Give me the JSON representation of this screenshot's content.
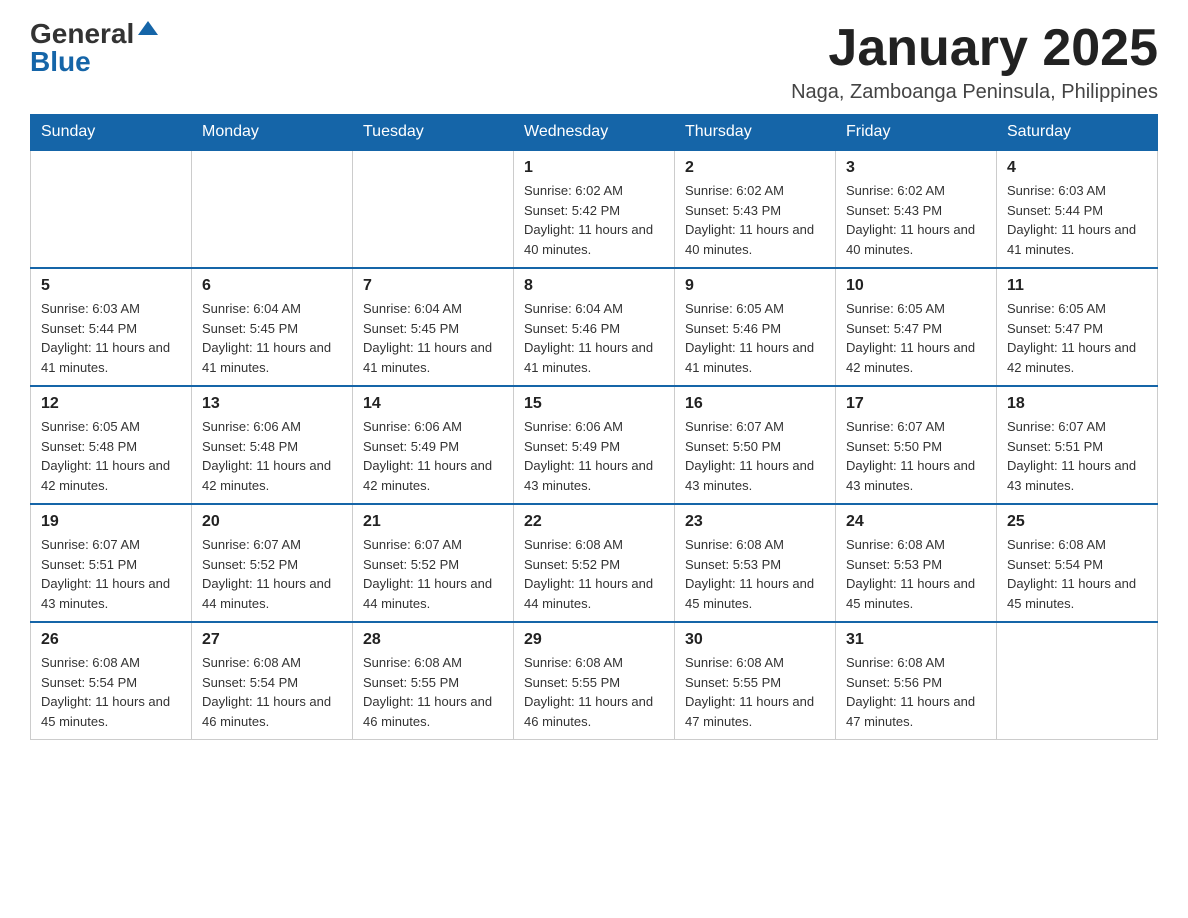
{
  "header": {
    "logo_general": "General",
    "logo_blue": "Blue",
    "title": "January 2025",
    "location": "Naga, Zamboanga Peninsula, Philippines"
  },
  "days_of_week": [
    "Sunday",
    "Monday",
    "Tuesday",
    "Wednesday",
    "Thursday",
    "Friday",
    "Saturday"
  ],
  "weeks": [
    [
      {
        "day": "",
        "info": ""
      },
      {
        "day": "",
        "info": ""
      },
      {
        "day": "",
        "info": ""
      },
      {
        "day": "1",
        "info": "Sunrise: 6:02 AM\nSunset: 5:42 PM\nDaylight: 11 hours and 40 minutes."
      },
      {
        "day": "2",
        "info": "Sunrise: 6:02 AM\nSunset: 5:43 PM\nDaylight: 11 hours and 40 minutes."
      },
      {
        "day": "3",
        "info": "Sunrise: 6:02 AM\nSunset: 5:43 PM\nDaylight: 11 hours and 40 minutes."
      },
      {
        "day": "4",
        "info": "Sunrise: 6:03 AM\nSunset: 5:44 PM\nDaylight: 11 hours and 41 minutes."
      }
    ],
    [
      {
        "day": "5",
        "info": "Sunrise: 6:03 AM\nSunset: 5:44 PM\nDaylight: 11 hours and 41 minutes."
      },
      {
        "day": "6",
        "info": "Sunrise: 6:04 AM\nSunset: 5:45 PM\nDaylight: 11 hours and 41 minutes."
      },
      {
        "day": "7",
        "info": "Sunrise: 6:04 AM\nSunset: 5:45 PM\nDaylight: 11 hours and 41 minutes."
      },
      {
        "day": "8",
        "info": "Sunrise: 6:04 AM\nSunset: 5:46 PM\nDaylight: 11 hours and 41 minutes."
      },
      {
        "day": "9",
        "info": "Sunrise: 6:05 AM\nSunset: 5:46 PM\nDaylight: 11 hours and 41 minutes."
      },
      {
        "day": "10",
        "info": "Sunrise: 6:05 AM\nSunset: 5:47 PM\nDaylight: 11 hours and 42 minutes."
      },
      {
        "day": "11",
        "info": "Sunrise: 6:05 AM\nSunset: 5:47 PM\nDaylight: 11 hours and 42 minutes."
      }
    ],
    [
      {
        "day": "12",
        "info": "Sunrise: 6:05 AM\nSunset: 5:48 PM\nDaylight: 11 hours and 42 minutes."
      },
      {
        "day": "13",
        "info": "Sunrise: 6:06 AM\nSunset: 5:48 PM\nDaylight: 11 hours and 42 minutes."
      },
      {
        "day": "14",
        "info": "Sunrise: 6:06 AM\nSunset: 5:49 PM\nDaylight: 11 hours and 42 minutes."
      },
      {
        "day": "15",
        "info": "Sunrise: 6:06 AM\nSunset: 5:49 PM\nDaylight: 11 hours and 43 minutes."
      },
      {
        "day": "16",
        "info": "Sunrise: 6:07 AM\nSunset: 5:50 PM\nDaylight: 11 hours and 43 minutes."
      },
      {
        "day": "17",
        "info": "Sunrise: 6:07 AM\nSunset: 5:50 PM\nDaylight: 11 hours and 43 minutes."
      },
      {
        "day": "18",
        "info": "Sunrise: 6:07 AM\nSunset: 5:51 PM\nDaylight: 11 hours and 43 minutes."
      }
    ],
    [
      {
        "day": "19",
        "info": "Sunrise: 6:07 AM\nSunset: 5:51 PM\nDaylight: 11 hours and 43 minutes."
      },
      {
        "day": "20",
        "info": "Sunrise: 6:07 AM\nSunset: 5:52 PM\nDaylight: 11 hours and 44 minutes."
      },
      {
        "day": "21",
        "info": "Sunrise: 6:07 AM\nSunset: 5:52 PM\nDaylight: 11 hours and 44 minutes."
      },
      {
        "day": "22",
        "info": "Sunrise: 6:08 AM\nSunset: 5:52 PM\nDaylight: 11 hours and 44 minutes."
      },
      {
        "day": "23",
        "info": "Sunrise: 6:08 AM\nSunset: 5:53 PM\nDaylight: 11 hours and 45 minutes."
      },
      {
        "day": "24",
        "info": "Sunrise: 6:08 AM\nSunset: 5:53 PM\nDaylight: 11 hours and 45 minutes."
      },
      {
        "day": "25",
        "info": "Sunrise: 6:08 AM\nSunset: 5:54 PM\nDaylight: 11 hours and 45 minutes."
      }
    ],
    [
      {
        "day": "26",
        "info": "Sunrise: 6:08 AM\nSunset: 5:54 PM\nDaylight: 11 hours and 45 minutes."
      },
      {
        "day": "27",
        "info": "Sunrise: 6:08 AM\nSunset: 5:54 PM\nDaylight: 11 hours and 46 minutes."
      },
      {
        "day": "28",
        "info": "Sunrise: 6:08 AM\nSunset: 5:55 PM\nDaylight: 11 hours and 46 minutes."
      },
      {
        "day": "29",
        "info": "Sunrise: 6:08 AM\nSunset: 5:55 PM\nDaylight: 11 hours and 46 minutes."
      },
      {
        "day": "30",
        "info": "Sunrise: 6:08 AM\nSunset: 5:55 PM\nDaylight: 11 hours and 47 minutes."
      },
      {
        "day": "31",
        "info": "Sunrise: 6:08 AM\nSunset: 5:56 PM\nDaylight: 11 hours and 47 minutes."
      },
      {
        "day": "",
        "info": ""
      }
    ]
  ]
}
